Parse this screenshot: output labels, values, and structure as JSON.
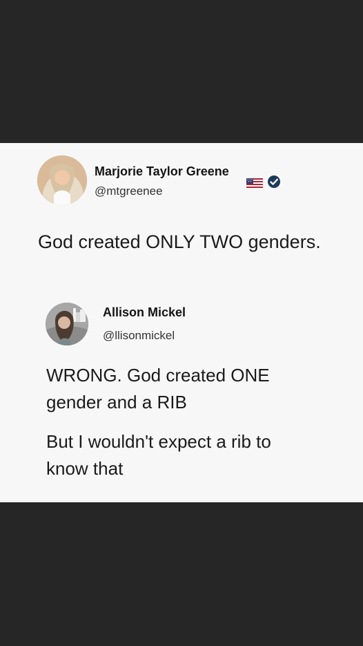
{
  "tweets": [
    {
      "name": "Marjorie Taylor Greene",
      "handle": "@mtgreenee",
      "text": "God created ONLY TWO genders."
    },
    {
      "name": "Allison Mickel",
      "handle": "@llisonmickel",
      "text_part1": "WRONG. God created ONE\ngender and a RIB",
      "text_part2": "But I wouldn't expect a rib to\nknow that"
    }
  ],
  "icons": {
    "flag": "us-flag-icon",
    "verified": "verified-badge-icon"
  },
  "colors": {
    "background": "#262626",
    "card": "#f7f7f7",
    "text": "#1a1a1a",
    "verified": "#1d3a5a"
  }
}
